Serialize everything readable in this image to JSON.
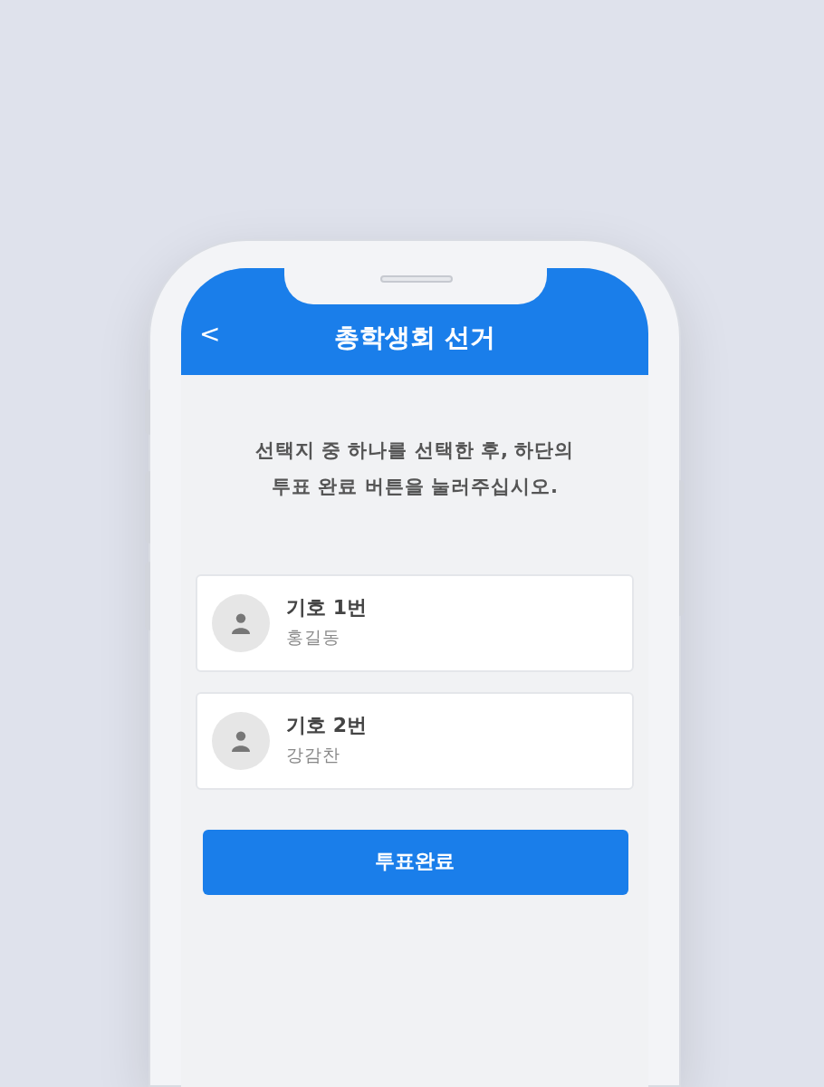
{
  "header": {
    "back": "<",
    "title": "총학생회 선거"
  },
  "instructions": "선택지 중 하나를 선택한 후, 하단의 투표 완료 버튼을 눌러주십시오.",
  "candidates": [
    {
      "number": "기호 1번",
      "name": "홍길동"
    },
    {
      "number": "기호 2번",
      "name": "강감찬"
    }
  ],
  "submit_button": "투표완료"
}
